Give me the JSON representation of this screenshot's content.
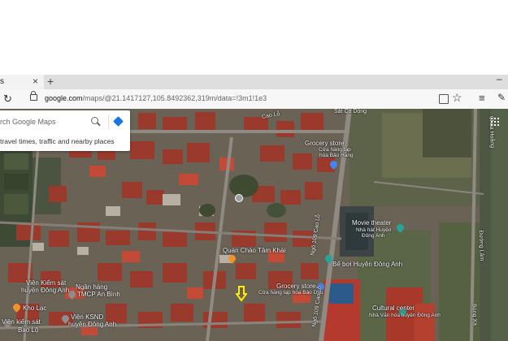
{
  "tab": {
    "close_glyph": "×",
    "new_tab_glyph": "+",
    "window_min": "–"
  },
  "address": {
    "host": "google.com",
    "path": "/maps/@21.1417127,105.8492362,319m/data=!3m1!1e3"
  },
  "search": {
    "placeholder": "rch Google Maps",
    "hint": "travel times, traffic and nearby places"
  },
  "labels": {
    "sat_co_dong": "Sắt Cổ Dộng",
    "grocery1_title": "Grocery store",
    "grocery1_sub1": "Cửa hàng tạp",
    "grocery1_sub2": "hóa Bảo Hằng",
    "quan_chao": "Quán Cháo Tâm Khải",
    "movie_title": "Movie theater",
    "movie_sub1": "Nhà hát Huyện",
    "movie_sub2": "Đông Anh",
    "be_boi": "Bể bơi Huyện Đông Anh",
    "grocery2_title": "Grocery store",
    "grocery2_sub": "Cửa hàng tạp hóa Bảo Dâu",
    "vien_ks1": "Viện Kiểm sát",
    "vien_ks2": "huyện Đông Anh",
    "ngan_hang1": "Ngân hàng",
    "ngan_hang2": "TMCP An Bình",
    "kho_lac": "Kho Lạc",
    "vien_ksnd1": "Viện KSND",
    "vien_ksnd2": "huyện Đông Anh",
    "vien_kiem1": "Viện kiểm sát",
    "vien_kiem2": "Bao Lộ",
    "cultural_title": "Cultural center",
    "cultural_sub": "Nhà Văn hóa huyện Đông Anh",
    "road1": "Ngõ 109 Cao Lỗ",
    "road2": "Ngõ 109 Cao Lỗ",
    "road3": "Cao Lỗ",
    "road4": "Đường Lâm",
    "road5": "Bùng Xá",
    "road6": "Chùa Hoằng"
  },
  "colors": {
    "search_blue": "#1a73e8",
    "grocery_blue": "#4285f4",
    "food_orange": "#f0932b",
    "teal": "#26a69a",
    "arrow_yellow": "#ffee00"
  }
}
